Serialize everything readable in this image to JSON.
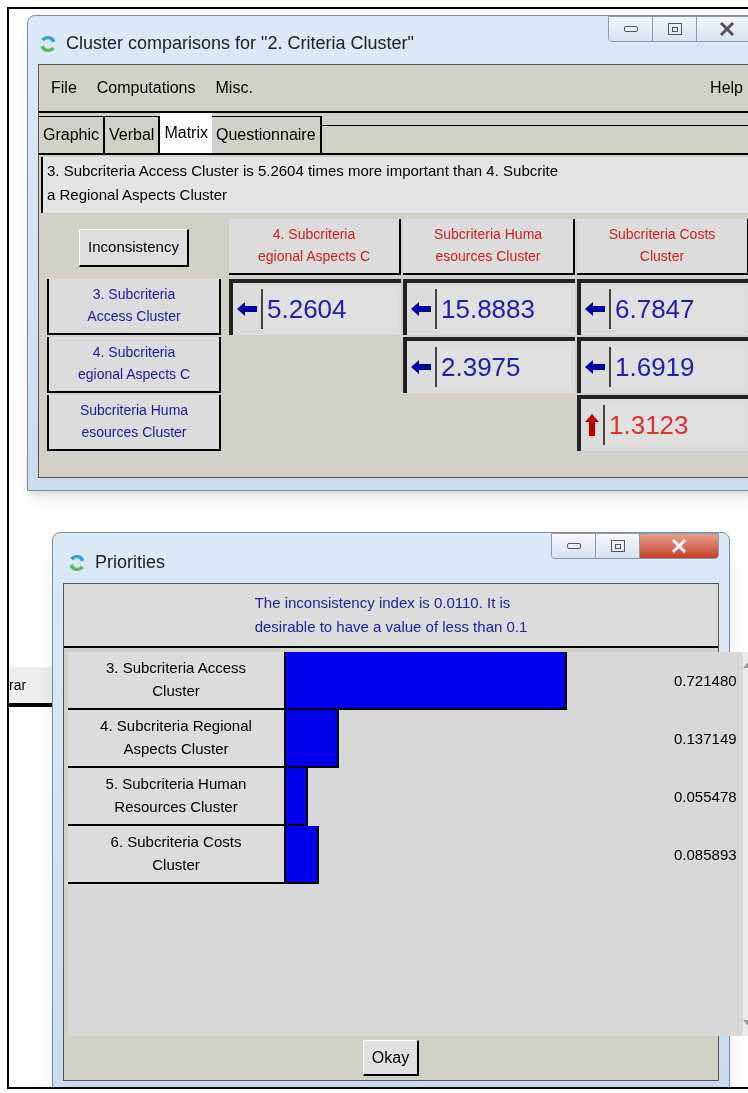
{
  "cluster_window": {
    "title": "Cluster comparisons for \"2. Criteria Cluster\"",
    "menu": [
      {
        "label": "File"
      },
      {
        "label": "Computations"
      },
      {
        "label": "Misc."
      }
    ],
    "help_menu": "Help",
    "tabs": [
      {
        "label": "Graphic",
        "selected": false
      },
      {
        "label": "Verbal",
        "selected": false
      },
      {
        "label": "Matrix",
        "selected": true
      },
      {
        "label": "Questionnaire",
        "selected": false
      }
    ],
    "description": "3. Subcriteria Access Cluster is 5.2604 times more important than  4. Subcrite\na Regional Aspects Cluster",
    "inconsistency_button": "Inconsistency",
    "column_headers": [
      "4. Subcriteria\negional Aspects C",
      "Subcriteria Huma\nesources Cluster",
      "Subcriteria Costs\nCluster"
    ],
    "rows": [
      {
        "header": "3. Subcriteria\nAccess Cluster",
        "cells": [
          {
            "value": "5.2604",
            "kind": "left"
          },
          {
            "value": "15.8883",
            "kind": "left"
          },
          {
            "value": "6.7847",
            "kind": "left"
          }
        ]
      },
      {
        "header": "4. Subcriteria\negional Aspects C",
        "cells": [
          null,
          {
            "value": "2.3975",
            "kind": "left"
          },
          {
            "value": "1.6919",
            "kind": "left"
          }
        ]
      },
      {
        "header": "Subcriteria Huma\nesources Cluster",
        "cells": [
          null,
          null,
          {
            "value": "1.3123",
            "kind": "up"
          }
        ]
      }
    ]
  },
  "background_fragment": "rar",
  "priorities_window": {
    "title": "Priorities",
    "message": "The inconsistency index is 0.0110.  It is\ndesirable to have a value of less than 0.1",
    "items": [
      {
        "label": "3. Subcriteria Access\nCluster",
        "level": 0.72148,
        "value": "0.721480"
      },
      {
        "label": "4. Subcriteria Regional\nAspects Cluster",
        "level": 0.137149,
        "value": "0.137149"
      },
      {
        "label": "5. Subcriteria Human\nResources Cluster",
        "level": 0.055478,
        "value": "0.055478"
      },
      {
        "label": "6. Subcriteria Costs\nCluster",
        "level": 0.085893,
        "value": "0.085893"
      }
    ],
    "okay_button": "Okay"
  }
}
